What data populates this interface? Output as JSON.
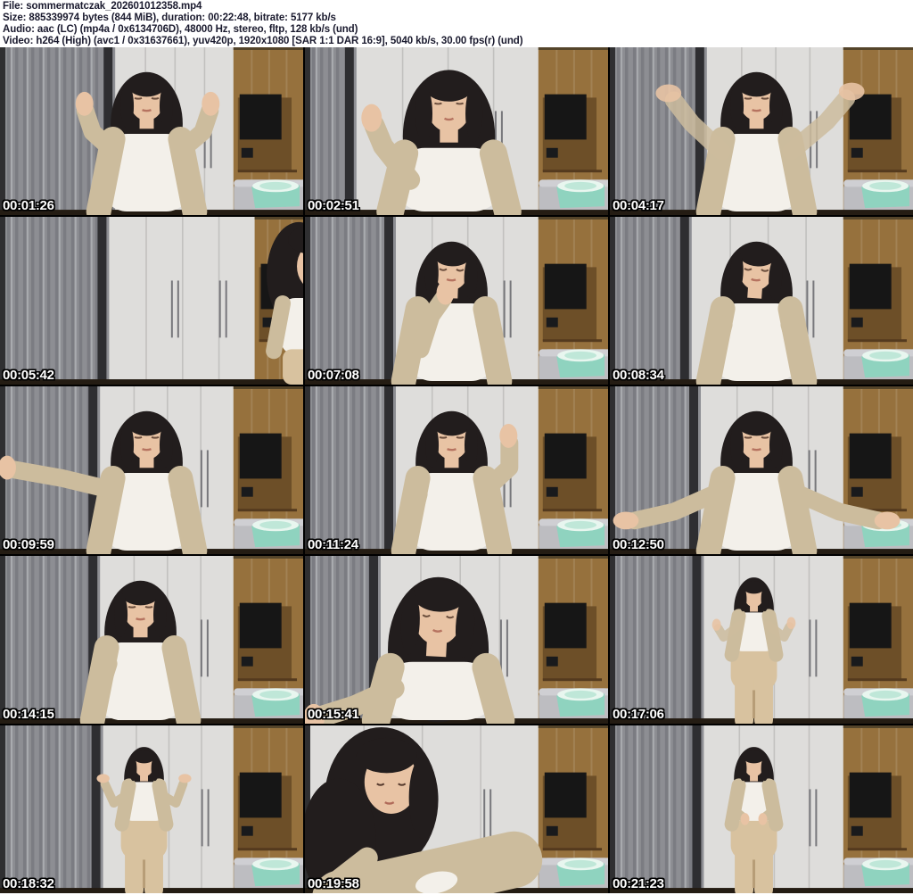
{
  "header": {
    "lines": [
      "File: sommermatczak_202601012358.mp4",
      "Size: 885339974 bytes (844 MiB), duration: 00:22:48, bitrate: 5177 kb/s",
      "Audio: aac (LC) (mp4a / 0x6134706D), 48000 Hz, stereo, fltp, 128 kb/s (und)",
      "Video: h264 (High) (avc1 / 0x31637661), yuv420p, 1920x1080 [SAR 1:1 DAR 16:9], 5040 kb/s, 30.00 fps(r) (und)"
    ]
  },
  "thumbnails": [
    {
      "timestamp": "00:01:26",
      "pose": "hands-up",
      "curtain": 0.38
    },
    {
      "timestamp": "00:02:51",
      "pose": "look-up-gesture",
      "curtain": 0.17
    },
    {
      "timestamp": "00:04:17",
      "pose": "wave-high",
      "curtain": 0.32
    },
    {
      "timestamp": "00:05:42",
      "pose": "room-person-right",
      "curtain": 0.36,
      "mint": false,
      "wood": 0.84
    },
    {
      "timestamp": "00:07:08",
      "pose": "touch-face",
      "curtain": 0.3
    },
    {
      "timestamp": "00:08:34",
      "pose": "eyes-closed",
      "curtain": 0.27
    },
    {
      "timestamp": "00:09:59",
      "pose": "arm-out-left",
      "curtain": 0.33
    },
    {
      "timestamp": "00:11:24",
      "pose": "hand-raised",
      "curtain": 0.3
    },
    {
      "timestamp": "00:12:50",
      "pose": "shrug",
      "curtain": 0.3
    },
    {
      "timestamp": "00:14:15",
      "pose": "talking",
      "curtain": 0.33
    },
    {
      "timestamp": "00:15:41",
      "pose": "look-down-close",
      "curtain": 0.25
    },
    {
      "timestamp": "00:17:06",
      "pose": "full-dance",
      "curtain": 0.31
    },
    {
      "timestamp": "00:18:32",
      "pose": "full-hands-up",
      "curtain": 0.34
    },
    {
      "timestamp": "00:19:58",
      "pose": "lean-close",
      "curtain": 0
    },
    {
      "timestamp": "00:21:23",
      "pose": "full-stand",
      "curtain": 0.31
    }
  ],
  "colors": {
    "header_text": "#1a1a2e",
    "timestamp_text": "#ffffff",
    "timestamp_outline": "#000000",
    "curtain": "#8d8e93",
    "curtain_fold": "#6f7076",
    "curtain_dark": "#2e2e31",
    "wardrobe": "#dedddb",
    "seam": "#c2c1bf",
    "handle": "#77777b",
    "wood": "#96713d",
    "wood_dark": "#6d4f28",
    "tv": "#161616",
    "table": "#bdbdc1",
    "mint": "#8fd3bf",
    "mint_rim": "#e8f6ef",
    "desk": "#241c13",
    "edge": "#2f2f31",
    "hair": "#221d1d",
    "skin": "#e8c3a4",
    "top": "#f3f0ea",
    "cardigan": "#ccbc9d",
    "leggings": "#d8c29f"
  }
}
